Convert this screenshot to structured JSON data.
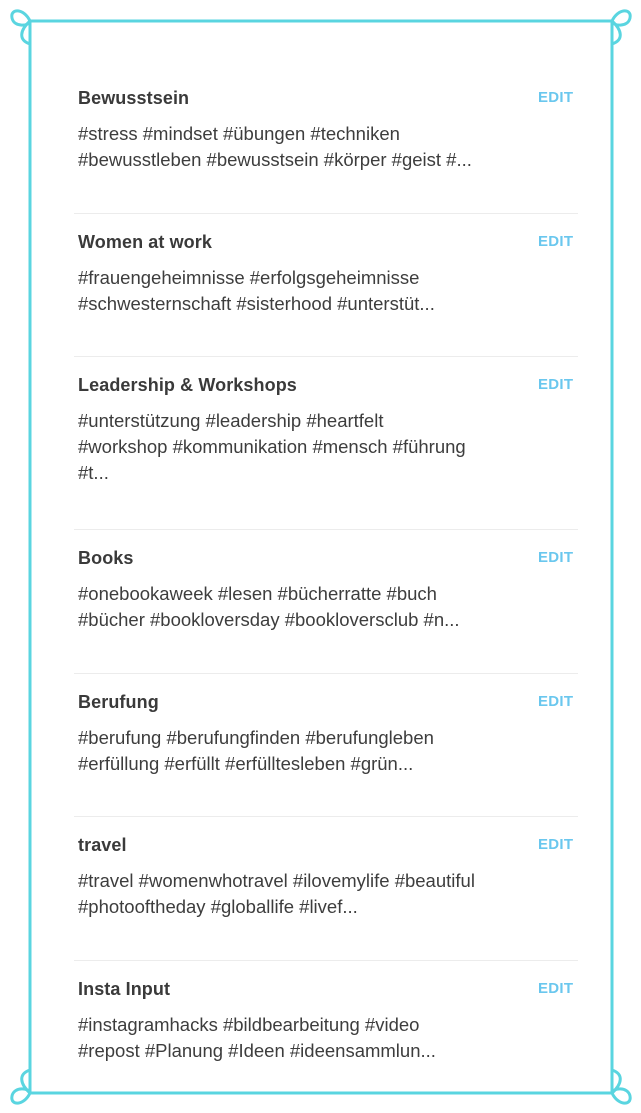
{
  "frame": {
    "border_color": "#5ad5e0"
  },
  "accent_color": "#6ac7ee",
  "groups": [
    {
      "title": "Bewusstsein",
      "edit_label": "EDIT",
      "hashtags": "#stress #mindset #übungen #techniken\n#bewusstleben #bewusstsein #körper #geist #..."
    },
    {
      "title": "Women at work",
      "edit_label": "EDIT",
      "hashtags": "#frauengeheimnisse #erfolgsgeheimnisse\n#schwesternschaft #sisterhood #unterstüt..."
    },
    {
      "title": "Leadership & Workshops",
      "edit_label": "EDIT",
      "hashtags": "#unterstützung #leadership #heartfelt\n#workshop #kommunikation #mensch #führung\n#t..."
    },
    {
      "title": "Books",
      "edit_label": "EDIT",
      "hashtags": "#onebookaweek #lesen #bücherratte #buch\n#bücher #bookloversday #bookloversclub #n..."
    },
    {
      "title": "Berufung",
      "edit_label": "EDIT",
      "hashtags": "#berufung #berufungfinden #berufungleben\n#erfüllung #erfüllt #erfülltesleben #grün..."
    },
    {
      "title": "travel",
      "edit_label": "EDIT",
      "hashtags": "#travel #womenwhotravel #ilovemylife #beautiful\n#photooftheday #globallife #livef..."
    },
    {
      "title": "Insta Input",
      "edit_label": "EDIT",
      "hashtags": "#instagramhacks #bildbearbeitung #video\n#repost #Planung #Ideen #ideensammlun..."
    }
  ]
}
